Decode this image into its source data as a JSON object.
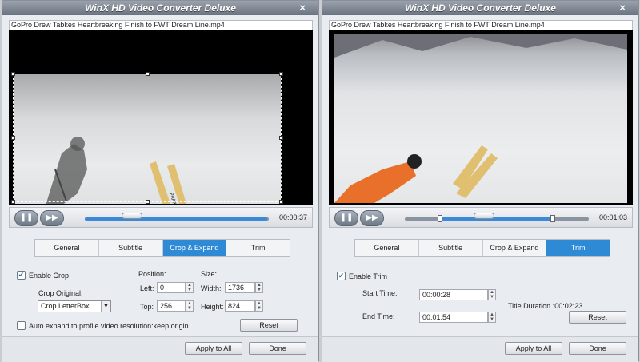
{
  "app_title": "WinX HD Video Converter Deluxe",
  "close_glyph": "×",
  "left": {
    "filename": "GoPro Drew Tabkes Heartbreaking Finish to FWT Dream Line.mp4",
    "time": "00:00:37",
    "progress": 0.98,
    "tabs": [
      "General",
      "Subtitle",
      "Crop & Expand",
      "Trim"
    ],
    "active_tab": "Crop & Expand",
    "enable_crop_label": "Enable Crop",
    "enable_crop_checked": true,
    "crop_original_label": "Crop Original:",
    "crop_original_value": "Crop LetterBox",
    "position_label": "Position:",
    "left_label": "Left:",
    "left_value": "0",
    "top_label": "Top:",
    "top_value": "256",
    "size_label": "Size:",
    "width_label": "Width:",
    "width_value": "1736",
    "height_label": "Height:",
    "height_value": "824",
    "auto_expand_label": "Auto expand to profile video resolution:keep origin",
    "auto_expand_checked": false,
    "reset_label": "Reset",
    "apply_label": "Apply to All",
    "done_label": "Done"
  },
  "right": {
    "filename": "GoPro Drew Tabkes Heartbreaking Finish to FWT Dream Line.mp4",
    "time": "00:01:03",
    "tabs": [
      "General",
      "Subtitle",
      "Crop & Expand",
      "Trim"
    ],
    "active_tab": "Trim",
    "enable_trim_label": "Enable Trim",
    "enable_trim_checked": true,
    "start_label": "Start Time:",
    "start_value": "00:00:28",
    "end_label": "End Time:",
    "end_value": "00:01:54",
    "duration_label": "Title Duration :00:02:23",
    "reset_label": "Reset",
    "apply_label": "Apply to All",
    "done_label": "Done"
  },
  "colors": {
    "accent": "#2f8ad6",
    "titlebar": "#6b7380"
  }
}
